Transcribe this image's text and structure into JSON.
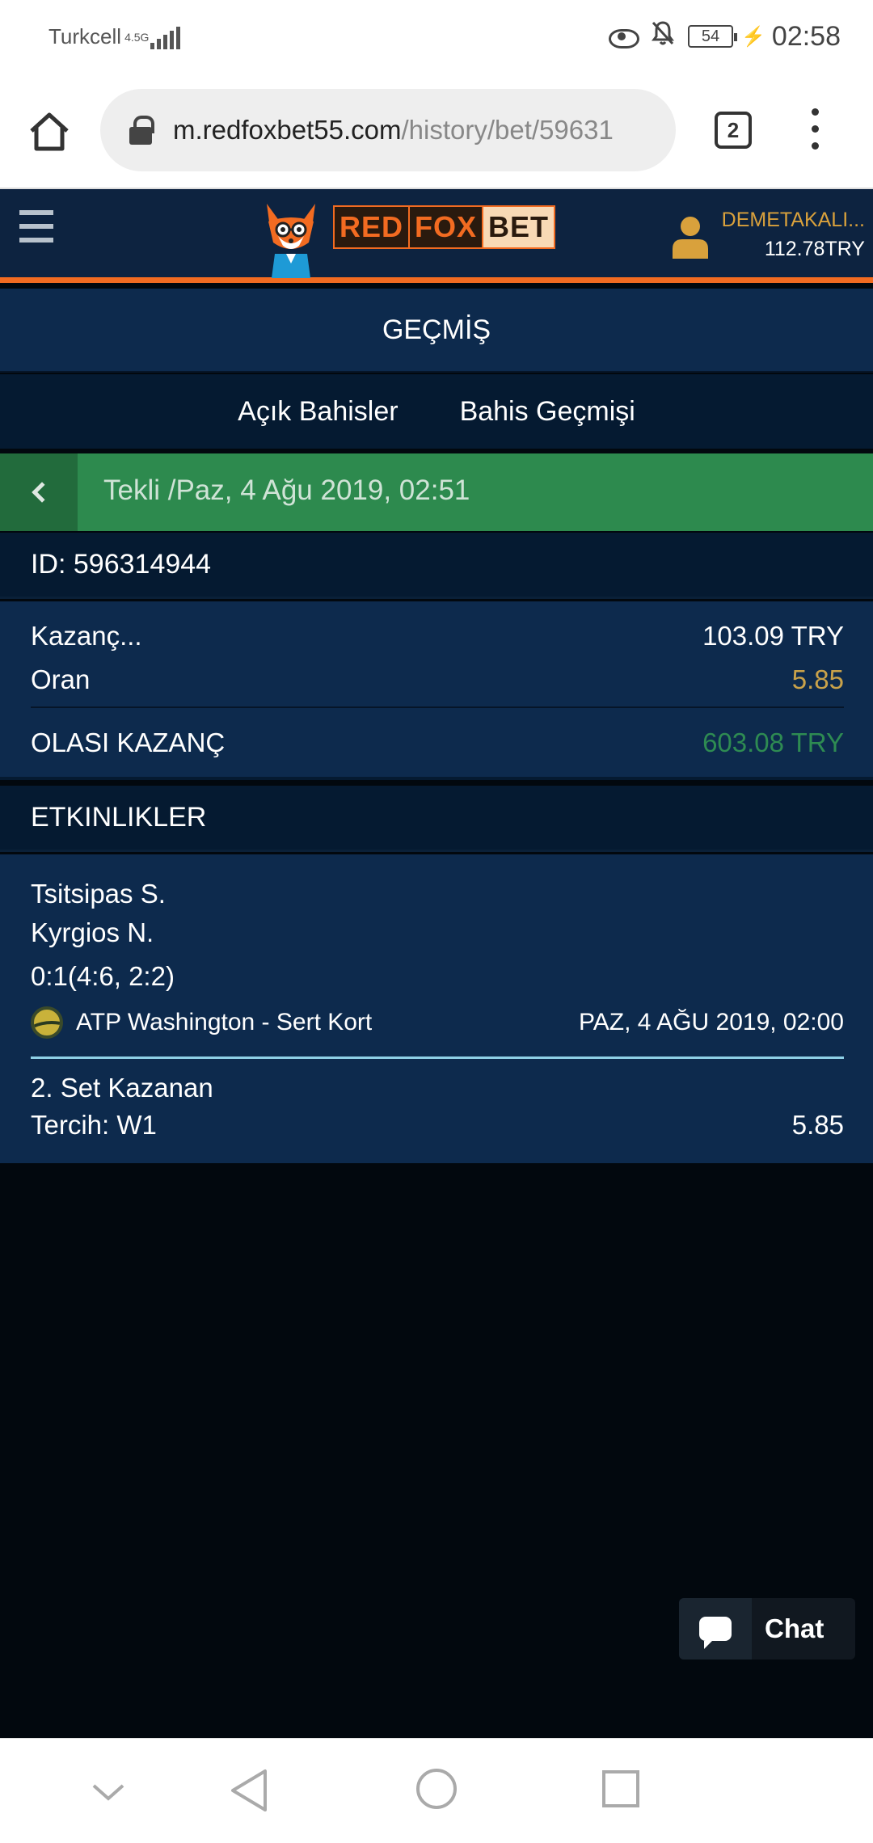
{
  "status_bar": {
    "carrier": "Turkcell",
    "network_type": "4.5G",
    "battery": "54",
    "time": "02:58"
  },
  "browser": {
    "url_domain": "m.redfoxbet55.com",
    "url_path": "/history/bet/59631",
    "tab_count": "2"
  },
  "header": {
    "logo_words": [
      "RED",
      "FOX",
      "BET"
    ],
    "username": "DEMETAKALI...",
    "balance": "112.78TRY"
  },
  "page": {
    "title": "GEÇMİŞ",
    "tabs": [
      {
        "label": "Açık Bahisler"
      },
      {
        "label": "Bahis Geçmişi"
      }
    ]
  },
  "bet": {
    "header_title": "Tekli /Paz, 4 Ağu 2019, 02:51",
    "id_text": "ID: 596314944",
    "stake_label": "Kazanç...",
    "stake_value": "103.09 TRY",
    "odds_label": "Oran",
    "odds_value": "5.85",
    "potential_label": "OLASI KAZANÇ",
    "potential_value": "603.08 TRY"
  },
  "events": {
    "heading": "ETKINLIKLER",
    "items": [
      {
        "player1": "Tsitsipas S.",
        "player2": "Kyrgios N.",
        "score": "0:1(4:6, 2:2)",
        "tournament": "ATP Washington - Sert Kort",
        "date": "PAZ, 4 AĞU 2019, 02:00",
        "market": "2. Set Kazanan",
        "selection": "Tercih: W1",
        "odds": "5.85"
      }
    ]
  },
  "chat": {
    "label": "Chat"
  },
  "colors": {
    "header_bg": "#0d2340",
    "accent_orange": "#f26b21",
    "panel_bg": "#0d2a4d",
    "dark_panel_bg": "#051a31",
    "green_bar": "#2d8a4e",
    "gold_text": "#c9a24a",
    "green_text": "#2e8b52"
  },
  "icons": [
    "home-icon",
    "lock-icon",
    "tabs-icon",
    "more-vert-icon",
    "hamburger-icon",
    "user-icon",
    "back-chevron-icon",
    "tennis-ball-icon",
    "chat-icon",
    "eye-icon",
    "bell-off-icon",
    "battery-icon",
    "charging-icon"
  ]
}
